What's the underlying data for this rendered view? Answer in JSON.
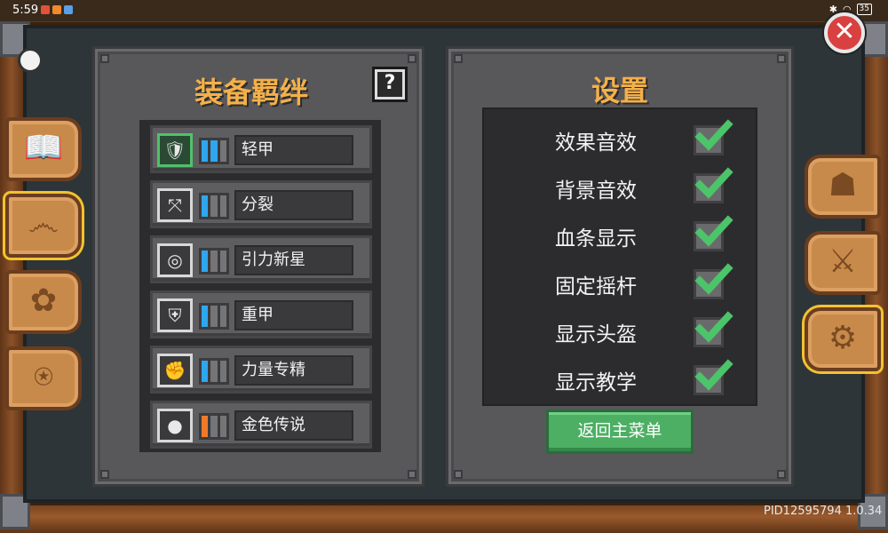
{
  "status_bar": {
    "time": "5:59",
    "battery": "35"
  },
  "bond_panel": {
    "title": "装备羁绊",
    "help_label": "?",
    "items": [
      {
        "label": "轻甲",
        "icon": "armor-icon",
        "glyph": "🛡",
        "meter": [
          true,
          true,
          false
        ],
        "meter_color": "#2fa6ee",
        "selected": true
      },
      {
        "label": "分裂",
        "icon": "split-arrows-icon",
        "glyph": "⤧",
        "meter": [
          true,
          false,
          false
        ],
        "meter_color": "#2fa6ee",
        "selected": false
      },
      {
        "label": "引力新星",
        "icon": "vortex-icon",
        "glyph": "◎",
        "meter": [
          true,
          false,
          false
        ],
        "meter_color": "#2fa6ee",
        "selected": false
      },
      {
        "label": "重甲",
        "icon": "heavy-armor-icon",
        "glyph": "⛨",
        "meter": [
          true,
          false,
          false
        ],
        "meter_color": "#2fa6ee",
        "selected": false
      },
      {
        "label": "力量专精",
        "icon": "fist-icon",
        "glyph": "✊",
        "meter": [
          true,
          false,
          false
        ],
        "meter_color": "#2fa6ee",
        "selected": false
      },
      {
        "label": "金色传说",
        "icon": "flame-orb-icon",
        "glyph": "●",
        "meter": [
          true,
          false,
          false
        ],
        "meter_color": "#f07a2a",
        "selected": false
      }
    ]
  },
  "settings_panel": {
    "title": "设置",
    "options": [
      {
        "label": "效果音效",
        "checked": true
      },
      {
        "label": "背景音效",
        "checked": true
      },
      {
        "label": "血条显示",
        "checked": true
      },
      {
        "label": "固定摇杆",
        "checked": true
      },
      {
        "label": "显示头盔",
        "checked": true
      },
      {
        "label": "显示教学",
        "checked": true
      }
    ],
    "main_menu_label": "返回主菜单"
  },
  "close_label": "✕",
  "left_tabs": [
    {
      "name": "book-icon",
      "glyph": "📖",
      "selected": false
    },
    {
      "name": "scroll-icon",
      "glyph": "෴",
      "selected": true
    },
    {
      "name": "paw-icon",
      "glyph": "✿",
      "selected": false
    },
    {
      "name": "wheel-icon",
      "glyph": "⍟",
      "selected": false
    }
  ],
  "right_tabs": [
    {
      "name": "helmet-icon",
      "glyph": "☗",
      "selected": false
    },
    {
      "name": "swords-icon",
      "glyph": "⚔",
      "selected": false
    },
    {
      "name": "gear-icon",
      "glyph": "⚙",
      "selected": true
    }
  ],
  "build_info": "PID12595794 1.0.34",
  "colors": {
    "accent_title": "#f4b04a",
    "check_green": "#4cc46a",
    "button_green": "#4caf63",
    "meter_blue": "#2fa6ee",
    "meter_orange": "#f07a2a"
  }
}
